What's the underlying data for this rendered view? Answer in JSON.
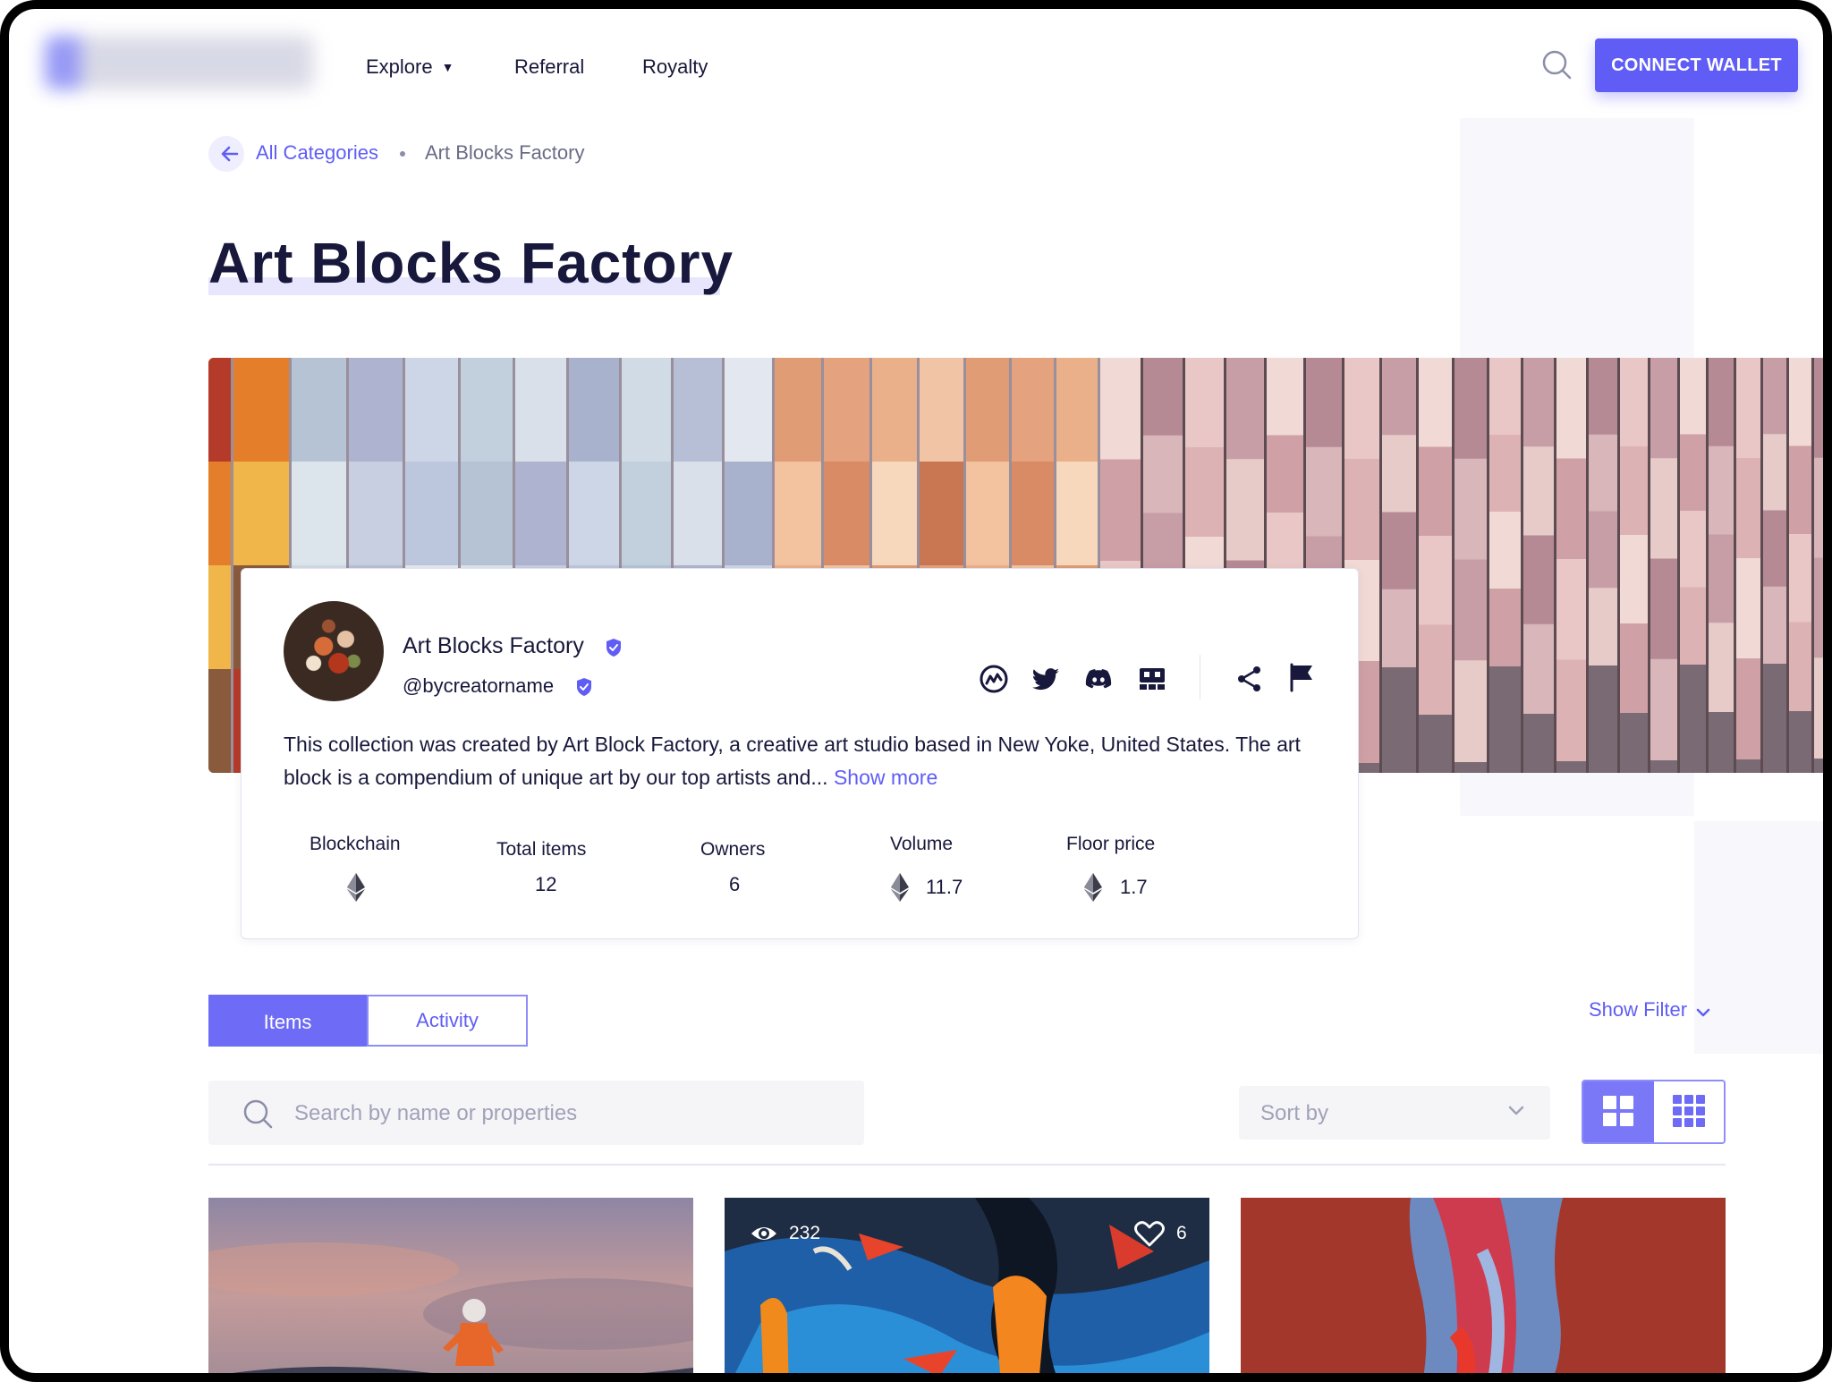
{
  "nav": {
    "explore": "Explore",
    "referral": "Referral",
    "royalty": "Royalty",
    "connect_wallet": "CONNECT WALLET"
  },
  "breadcrumb": {
    "back_label": "All Categories",
    "current": "Art Blocks Factory"
  },
  "page_title": "Art Blocks Factory",
  "collection": {
    "name": "Art Blocks Factory",
    "handle": "@bycreatorname",
    "description": "This collection was created by Art Block Factory, a creative art studio based in New Yoke, United States. The art block is a compendium of unique art by our top artists and...",
    "show_more": "Show more",
    "social_icons": [
      "coinmarketcap-icon",
      "twitter-icon",
      "discord-icon",
      "opensea-icon",
      "share-icon",
      "flag-icon"
    ],
    "stats": {
      "blockchain_label": "Blockchain",
      "total_items_label": "Total items",
      "total_items": "12",
      "owners_label": "Owners",
      "owners": "6",
      "volume_label": "Volume",
      "volume": "11.7",
      "floor_label": "Floor price",
      "floor": "1.7"
    }
  },
  "tabs": {
    "items": "Items",
    "activity": "Activity",
    "active": "items"
  },
  "filter": {
    "show_filter": "Show Filter",
    "search_placeholder": "Search by name or properties",
    "sort_placeholder": "Sort by",
    "view_mode": "large-grid"
  },
  "cards": [
    {
      "views": "",
      "likes": ""
    },
    {
      "views": "232",
      "likes": "6"
    },
    {
      "views": "",
      "likes": ""
    }
  ],
  "colors": {
    "accent": "#5f5df6",
    "text": "#17183b"
  }
}
